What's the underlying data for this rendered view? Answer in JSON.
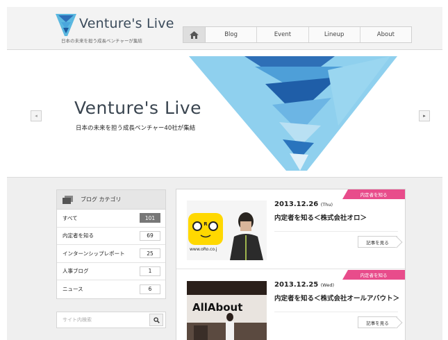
{
  "header": {
    "logo_title": "Venture's Live",
    "logo_sub": "日本の未来を担う成長ベンチャーが集結",
    "nav": [
      {
        "label": "Blog"
      },
      {
        "label": "Event"
      },
      {
        "label": "Lineup"
      },
      {
        "label": "About"
      }
    ],
    "home_icon": "home-icon"
  },
  "hero": {
    "title": "Venture's Live",
    "subtitle": "日本の未来を担う成長ベンチャー40社が集結",
    "prev_icon": "◂",
    "next_icon": "▸"
  },
  "sidebar": {
    "category_title": "ブログ カテゴリ",
    "categories": [
      {
        "label": "すべて",
        "count": "101",
        "active": true
      },
      {
        "label": "内定者を知る",
        "count": "69"
      },
      {
        "label": "インターンシップレポート",
        "count": "25"
      },
      {
        "label": "人事ブログ",
        "count": "1"
      },
      {
        "label": "ニュース",
        "count": "6"
      }
    ],
    "search_placeholder": "サイト内検索"
  },
  "posts": [
    {
      "badge": "内定者を知る",
      "date": "2013.12.26",
      "dow": "(Thu)",
      "title": "内定者を知る＜株式会社オロ＞",
      "more": "記事を見る",
      "thumb_text": "www.oRo.co.j"
    },
    {
      "badge": "内定者を知る",
      "date": "2013.12.25",
      "dow": "(Wed)",
      "title": "内定者を知る＜株式会社オールアバウト＞",
      "more": "記事を見る",
      "thumb_text": "AllAbout"
    }
  ],
  "colors": {
    "accent_pink": "#e84c8b",
    "brand_blue": "#3c8fd6"
  }
}
